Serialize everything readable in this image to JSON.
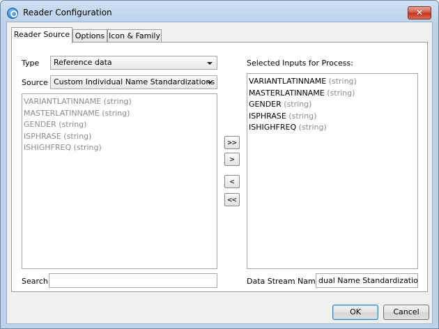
{
  "window": {
    "title": "Reader Configuration",
    "close_glyph": "✕"
  },
  "tabs": [
    "Reader Source",
    "Options",
    "Icon & Family"
  ],
  "form": {
    "type_label": "Type",
    "type_value": "Reference data",
    "source_label": "Source",
    "source_value": "Custom Individual Name Standardizations",
    "search_label": "Search",
    "search_value": ""
  },
  "available_inputs": [
    {
      "name": "VARIANTLATINNAME",
      "type": "(string)"
    },
    {
      "name": "MASTERLATINNAME",
      "type": "(string)"
    },
    {
      "name": "GENDER",
      "type": "(string)"
    },
    {
      "name": "ISPHRASE",
      "type": "(string)"
    },
    {
      "name": "ISHIGHFREQ",
      "type": "(string)"
    }
  ],
  "move_buttons": {
    "add_all": ">>",
    "add": ">",
    "remove": "<",
    "remove_all": "<<"
  },
  "selected": {
    "label": "Selected Inputs for Process:",
    "items": [
      {
        "name": "VARIANTLATINNAME",
        "type": "(string)"
      },
      {
        "name": "MASTERLATINNAME",
        "type": "(string)"
      },
      {
        "name": "GENDER",
        "type": "(string)"
      },
      {
        "name": "ISPHRASE",
        "type": "(string)"
      },
      {
        "name": "ISHIGHFREQ",
        "type": "(string)"
      }
    ]
  },
  "stream": {
    "label": "Data Stream Name",
    "value": "dual Name Standardizations"
  },
  "buttons": {
    "ok": "OK",
    "cancel": "Cancel"
  }
}
